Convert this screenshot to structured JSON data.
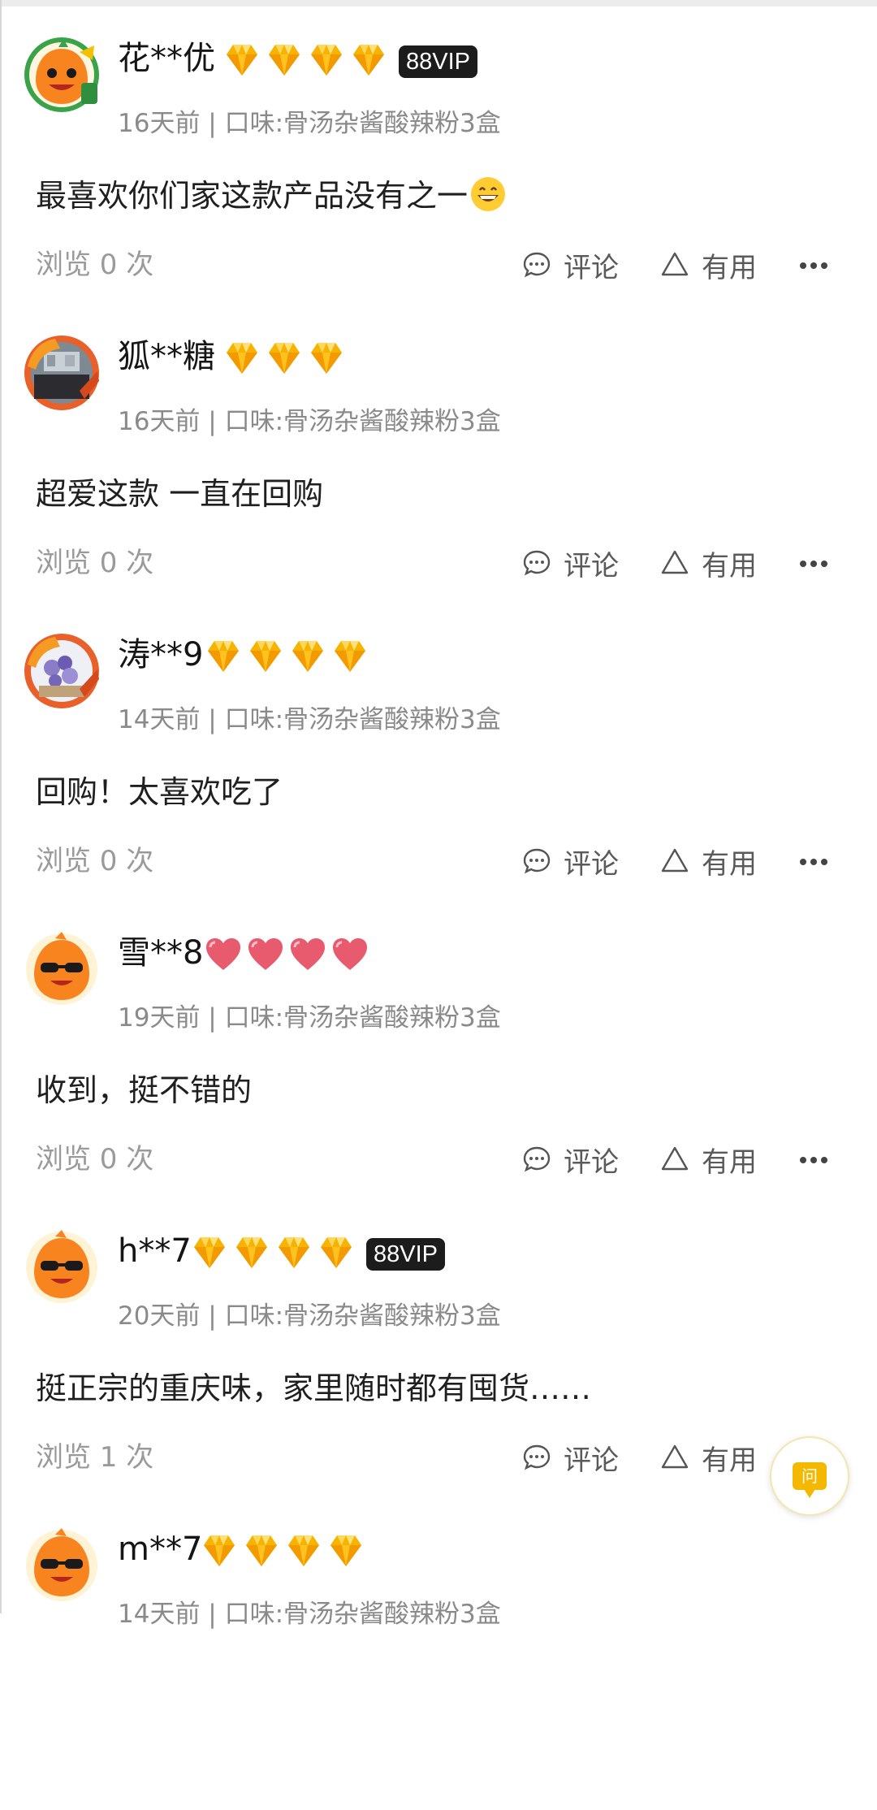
{
  "reviews": [
    {
      "user": "花**优",
      "badge_type": "diamond",
      "badge_count": 4,
      "vip": "88VIP",
      "avatar": "orange-mascot-avatar",
      "meta": "16天前 | 口味:骨汤杂酱酸辣粉3盒",
      "content": "最喜欢你们家这款产品没有之一",
      "content_emoji": "grinning-face-emoji",
      "views": "浏览 0 次",
      "comment": "评论",
      "useful": "有用"
    },
    {
      "user": "狐**糖",
      "badge_type": "diamond",
      "badge_count": 3,
      "vip": "",
      "avatar": "photo-avatar",
      "meta": "16天前 | 口味:骨汤杂酱酸辣粉3盒",
      "content": "超爱这款 一直在回购",
      "views": "浏览 0 次",
      "comment": "评论",
      "useful": "有用"
    },
    {
      "user": "涛**9",
      "badge_type": "diamond",
      "badge_count": 4,
      "vip": "",
      "avatar": "flower-photo-avatar",
      "meta": "14天前 | 口味:骨汤杂酱酸辣粉3盒",
      "content": "回购！太喜欢吃了",
      "views": "浏览 0 次",
      "comment": "评论",
      "useful": "有用"
    },
    {
      "user": "雪**8",
      "badge_type": "heart",
      "badge_count": 4,
      "vip": "",
      "avatar": "sunglasses-mascot-avatar",
      "meta": "19天前 | 口味:骨汤杂酱酸辣粉3盒",
      "content": "收到，挺不错的",
      "views": "浏览 0 次",
      "comment": "评论",
      "useful": "有用"
    },
    {
      "user": "h**7",
      "badge_type": "diamond",
      "badge_count": 4,
      "vip": "88VIP",
      "avatar": "sunglasses-mascot-avatar",
      "meta": "20天前 | 口味:骨汤杂酱酸辣粉3盒",
      "content": "挺正宗的重庆味，家里随时都有囤货……",
      "views": "浏览 1 次",
      "comment": "评论",
      "useful": "有用"
    },
    {
      "user": "m**7",
      "badge_type": "diamond",
      "badge_count": 4,
      "vip": "",
      "avatar": "sunglasses-mascot-avatar",
      "meta": "14天前 | 口味:骨汤杂酱酸辣粉3盒",
      "content": "",
      "views": "",
      "comment": "",
      "useful": ""
    }
  ],
  "float_button": {
    "label": "问",
    "icon": "question-bubble-icon"
  },
  "colors": {
    "diamond": "#f6b400",
    "heart": "#e85a6e",
    "vip_bg": "#1c1c1c",
    "meta": "#8a8a8a"
  }
}
